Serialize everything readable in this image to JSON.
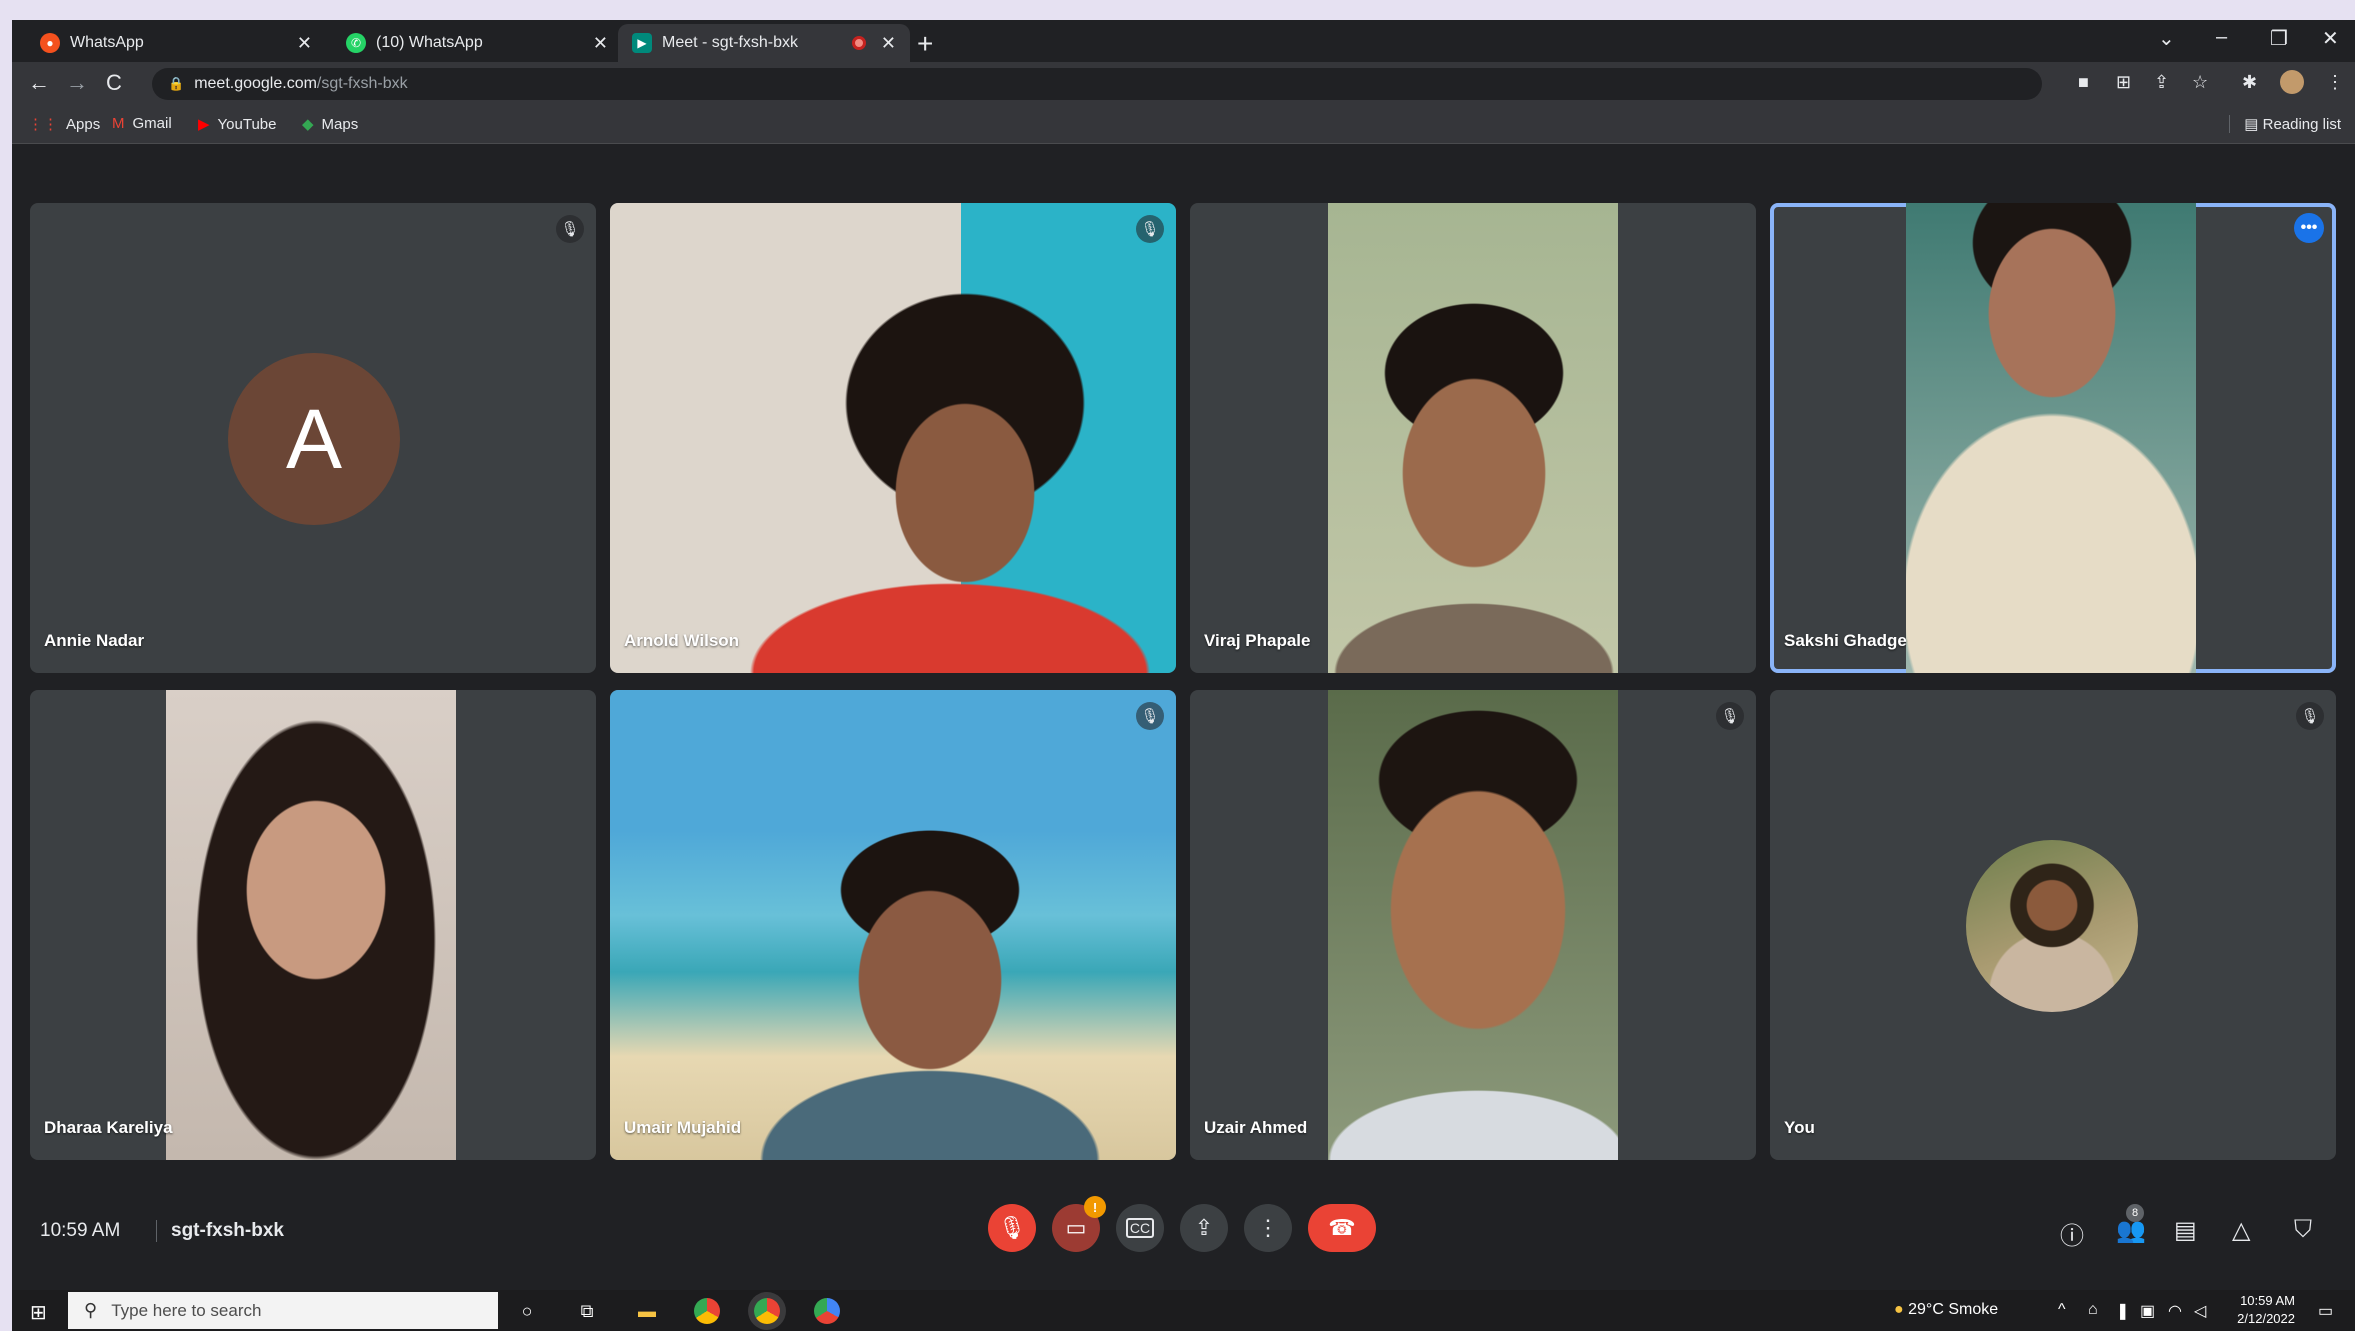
{
  "browser": {
    "tabs": [
      {
        "title": "WhatsApp",
        "active": false
      },
      {
        "title": "(10) WhatsApp",
        "active": false
      },
      {
        "title": "Meet - sgt-fxsh-bxk",
        "active": true
      }
    ],
    "url_host": "meet.google.com",
    "url_path": "/sgt-fxsh-bxk",
    "bookmarks": [
      "Apps",
      "Gmail",
      "YouTube",
      "Maps"
    ],
    "reading_list": "Reading list"
  },
  "meeting": {
    "participants": [
      {
        "name": "Annie Nadar",
        "avatar_letter": "A",
        "muted": true
      },
      {
        "name": "Arnold Wilson",
        "muted": true
      },
      {
        "name": "Viraj Phapale",
        "muted": false
      },
      {
        "name": "Sakshi Ghadge",
        "muted": false,
        "active_speaker": true
      },
      {
        "name": "Dharaa Kareliya",
        "muted": false
      },
      {
        "name": "Umair Mujahid",
        "muted": true
      },
      {
        "name": "Uzair Ahmed",
        "muted": true
      },
      {
        "name": "You",
        "muted": true
      }
    ],
    "time": "10:59 AM",
    "code": "sgt-fxsh-bxk",
    "camera_badge": "!",
    "people_count": "8",
    "more_dots": "•••"
  },
  "taskbar": {
    "search_placeholder": "Type here to search",
    "weather": "29°C  Smoke",
    "clock_time": "10:59 AM",
    "clock_date": "2/12/2022"
  }
}
